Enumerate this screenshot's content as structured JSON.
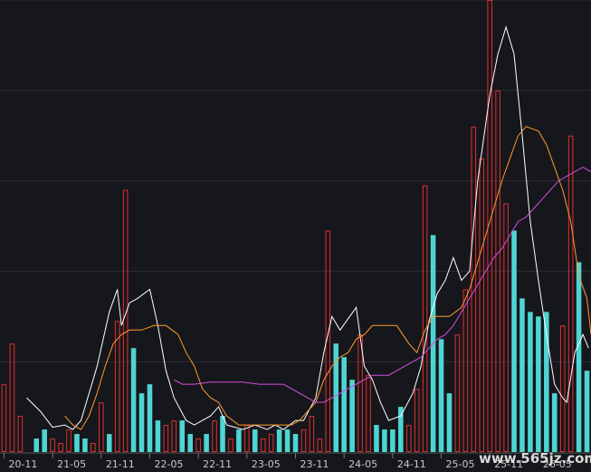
{
  "chart_data": {
    "type": "bar",
    "x_ticks": [
      "20-11",
      "21-05",
      "21-11",
      "22-05",
      "22-11",
      "23-05",
      "23-11",
      "24-05",
      "24-11",
      "25-05",
      "25-11",
      "26-05"
    ],
    "ylim": [
      0,
      100
    ],
    "grid": true,
    "colors": {
      "background": "#16171c",
      "grid": "#2a2d36",
      "up_bar": "#e0302e",
      "down_bar": "#4fd4d4",
      "ma_white": "#ffffff",
      "ma_orange": "#ff9a2e",
      "ma_magenta": "#d84ddc"
    },
    "bars": [
      {
        "v": 15,
        "up": true
      },
      {
        "v": 24,
        "up": true
      },
      {
        "v": 8,
        "up": true
      },
      {
        "v": 0,
        "up": true
      },
      {
        "v": 3,
        "up": false
      },
      {
        "v": 5,
        "up": false
      },
      {
        "v": 3,
        "up": true
      },
      {
        "v": 2,
        "up": true
      },
      {
        "v": 5,
        "up": true
      },
      {
        "v": 4,
        "up": false
      },
      {
        "v": 3,
        "up": false
      },
      {
        "v": 2,
        "up": true
      },
      {
        "v": 11,
        "up": true
      },
      {
        "v": 4,
        "up": false
      },
      {
        "v": 29,
        "up": true
      },
      {
        "v": 58,
        "up": true
      },
      {
        "v": 23,
        "up": false
      },
      {
        "v": 13,
        "up": false
      },
      {
        "v": 15,
        "up": false
      },
      {
        "v": 7,
        "up": false
      },
      {
        "v": 6,
        "up": true
      },
      {
        "v": 7,
        "up": true
      },
      {
        "v": 7,
        "up": false
      },
      {
        "v": 4,
        "up": false
      },
      {
        "v": 3,
        "up": true
      },
      {
        "v": 4,
        "up": false
      },
      {
        "v": 7,
        "up": true
      },
      {
        "v": 8,
        "up": false
      },
      {
        "v": 3,
        "up": true
      },
      {
        "v": 5,
        "up": false
      },
      {
        "v": 6,
        "up": true
      },
      {
        "v": 5,
        "up": false
      },
      {
        "v": 3,
        "up": true
      },
      {
        "v": 4,
        "up": true
      },
      {
        "v": 5,
        "up": false
      },
      {
        "v": 5,
        "up": false
      },
      {
        "v": 4,
        "up": false
      },
      {
        "v": 5,
        "up": true
      },
      {
        "v": 8,
        "up": true
      },
      {
        "v": 3,
        "up": true
      },
      {
        "v": 49,
        "up": true
      },
      {
        "v": 24,
        "up": false
      },
      {
        "v": 21,
        "up": false
      },
      {
        "v": 16,
        "up": false
      },
      {
        "v": 26,
        "up": true
      },
      {
        "v": 17,
        "up": true
      },
      {
        "v": 6,
        "up": false
      },
      {
        "v": 5,
        "up": false
      },
      {
        "v": 5,
        "up": false
      },
      {
        "v": 10,
        "up": false
      },
      {
        "v": 6,
        "up": true
      },
      {
        "v": 14,
        "up": true
      },
      {
        "v": 59,
        "up": true
      },
      {
        "v": 48,
        "up": false
      },
      {
        "v": 25,
        "up": false
      },
      {
        "v": 13,
        "up": false
      },
      {
        "v": 26,
        "up": true
      },
      {
        "v": 36,
        "up": true
      },
      {
        "v": 72,
        "up": true
      },
      {
        "v": 65,
        "up": true
      },
      {
        "v": 100,
        "up": true
      },
      {
        "v": 80,
        "up": true
      },
      {
        "v": 55,
        "up": true
      },
      {
        "v": 49,
        "up": false
      },
      {
        "v": 34,
        "up": false
      },
      {
        "v": 31,
        "up": false
      },
      {
        "v": 30,
        "up": false
      },
      {
        "v": 31,
        "up": false
      },
      {
        "v": 13,
        "up": false
      },
      {
        "v": 28,
        "up": true
      },
      {
        "v": 70,
        "up": true
      },
      {
        "v": 42,
        "up": false
      },
      {
        "v": 18,
        "up": false
      }
    ],
    "ma_lines": [
      {
        "color": "ma_white",
        "points": [
          [
            3.3,
            12
          ],
          [
            5,
            9
          ],
          [
            6.5,
            5.5
          ],
          [
            8,
            6
          ],
          [
            9,
            5
          ],
          [
            10,
            7
          ],
          [
            12,
            19
          ],
          [
            13.5,
            31
          ],
          [
            14.5,
            36
          ],
          [
            15,
            28
          ],
          [
            16,
            33
          ],
          [
            17,
            34
          ],
          [
            18.5,
            36
          ],
          [
            19.5,
            28
          ],
          [
            20.5,
            18
          ],
          [
            21.5,
            12
          ],
          [
            23,
            7
          ],
          [
            24,
            6
          ],
          [
            25,
            7
          ],
          [
            26,
            8
          ],
          [
            27,
            10
          ],
          [
            28,
            6
          ],
          [
            30,
            5
          ],
          [
            31.5,
            6
          ],
          [
            33,
            5
          ],
          [
            34,
            6
          ],
          [
            35,
            5
          ],
          [
            36.5,
            7
          ],
          [
            37.5,
            7
          ],
          [
            39,
            12
          ],
          [
            40,
            22
          ],
          [
            41,
            30
          ],
          [
            42,
            27
          ],
          [
            44,
            32
          ],
          [
            45,
            19
          ],
          [
            46,
            16
          ],
          [
            47,
            11
          ],
          [
            48,
            7
          ],
          [
            49.5,
            8
          ],
          [
            51,
            13
          ],
          [
            52,
            19
          ],
          [
            53,
            29
          ],
          [
            54,
            35
          ],
          [
            55,
            38
          ],
          [
            56,
            43
          ],
          [
            57,
            38
          ],
          [
            58,
            40
          ],
          [
            59,
            60
          ],
          [
            60.5,
            79
          ],
          [
            61.5,
            88
          ],
          [
            62.5,
            94
          ],
          [
            63.5,
            88
          ],
          [
            64.5,
            70
          ],
          [
            65.5,
            51
          ],
          [
            66.5,
            38
          ],
          [
            67.5,
            26
          ],
          [
            68.5,
            15
          ],
          [
            69.5,
            12
          ],
          [
            70,
            11
          ],
          [
            71,
            22
          ],
          [
            72,
            26
          ],
          [
            72.7,
            23
          ]
        ]
      },
      {
        "color": "ma_orange",
        "points": [
          [
            8,
            8
          ],
          [
            9,
            6
          ],
          [
            10,
            5
          ],
          [
            11,
            8
          ],
          [
            12,
            13
          ],
          [
            13,
            19
          ],
          [
            14,
            24
          ],
          [
            15,
            26
          ],
          [
            16,
            27
          ],
          [
            17.5,
            27
          ],
          [
            19,
            28
          ],
          [
            20.5,
            28
          ],
          [
            22,
            26
          ],
          [
            23,
            22
          ],
          [
            24,
            19
          ],
          [
            25,
            14
          ],
          [
            26,
            12
          ],
          [
            27,
            11
          ],
          [
            28,
            8
          ],
          [
            29.5,
            6
          ],
          [
            31,
            6
          ],
          [
            32.5,
            6
          ],
          [
            34,
            6
          ],
          [
            35,
            6
          ],
          [
            36,
            6
          ],
          [
            37,
            7
          ],
          [
            38,
            9
          ],
          [
            39,
            11
          ],
          [
            40,
            16
          ],
          [
            41,
            19
          ],
          [
            42,
            21
          ],
          [
            43,
            22
          ],
          [
            44,
            25
          ],
          [
            45,
            26
          ],
          [
            46,
            28
          ],
          [
            47,
            28
          ],
          [
            48,
            28
          ],
          [
            49,
            28
          ],
          [
            50.5,
            24
          ],
          [
            51.5,
            22
          ],
          [
            52.5,
            27
          ],
          [
            53.5,
            30
          ],
          [
            54.5,
            30
          ],
          [
            55.5,
            30
          ],
          [
            57,
            32
          ],
          [
            58,
            36
          ],
          [
            59,
            42
          ],
          [
            60,
            48
          ],
          [
            61,
            54
          ],
          [
            62,
            60
          ],
          [
            63,
            65
          ],
          [
            64,
            70
          ],
          [
            65,
            72
          ],
          [
            66.5,
            71
          ],
          [
            67.5,
            68
          ],
          [
            68.5,
            63
          ],
          [
            69.5,
            58
          ],
          [
            70.5,
            51
          ],
          [
            71.5,
            39
          ],
          [
            72.5,
            34
          ],
          [
            73,
            26
          ]
        ]
      },
      {
        "color": "ma_magenta",
        "points": [
          [
            21.5,
            16
          ],
          [
            22.5,
            15
          ],
          [
            24,
            15
          ],
          [
            26,
            15.5
          ],
          [
            28,
            15.5
          ],
          [
            30,
            15.5
          ],
          [
            32,
            15
          ],
          [
            33.5,
            15
          ],
          [
            35,
            15
          ],
          [
            36,
            14
          ],
          [
            37,
            13
          ],
          [
            38,
            12
          ],
          [
            39,
            11
          ],
          [
            40,
            11
          ],
          [
            41,
            12
          ],
          [
            42,
            13
          ],
          [
            43,
            14
          ],
          [
            44,
            15
          ],
          [
            45,
            16
          ],
          [
            46,
            17
          ],
          [
            47,
            17
          ],
          [
            48,
            17
          ],
          [
            49,
            18
          ],
          [
            50,
            19
          ],
          [
            51,
            20
          ],
          [
            52,
            21
          ],
          [
            53,
            23
          ],
          [
            54,
            25
          ],
          [
            55,
            26
          ],
          [
            56,
            28
          ],
          [
            57,
            31
          ],
          [
            58,
            34
          ],
          [
            59,
            37
          ],
          [
            60,
            40
          ],
          [
            61,
            43
          ],
          [
            62,
            45
          ],
          [
            63,
            48
          ],
          [
            64,
            51
          ],
          [
            65,
            52
          ],
          [
            66,
            54
          ],
          [
            67,
            56
          ],
          [
            68,
            58
          ],
          [
            69,
            60
          ],
          [
            70,
            61
          ],
          [
            71,
            62
          ],
          [
            72,
            63
          ],
          [
            73,
            62
          ]
        ]
      }
    ]
  },
  "watermark": "www.565jz.com"
}
